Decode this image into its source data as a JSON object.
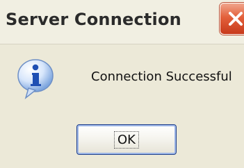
{
  "window": {
    "title": "Server Connection"
  },
  "message": {
    "text": "Connection Successful"
  },
  "buttons": {
    "ok_label": "OK"
  },
  "icons": {
    "close": "close-icon",
    "info": "info-icon"
  },
  "colors": {
    "dialog_bg": "#ece9d8",
    "titlebar_bg": "#f1efe2",
    "close_button": "#e3603b",
    "ok_border": "#1f3f8a",
    "info_blue": "#3b6fc7"
  }
}
